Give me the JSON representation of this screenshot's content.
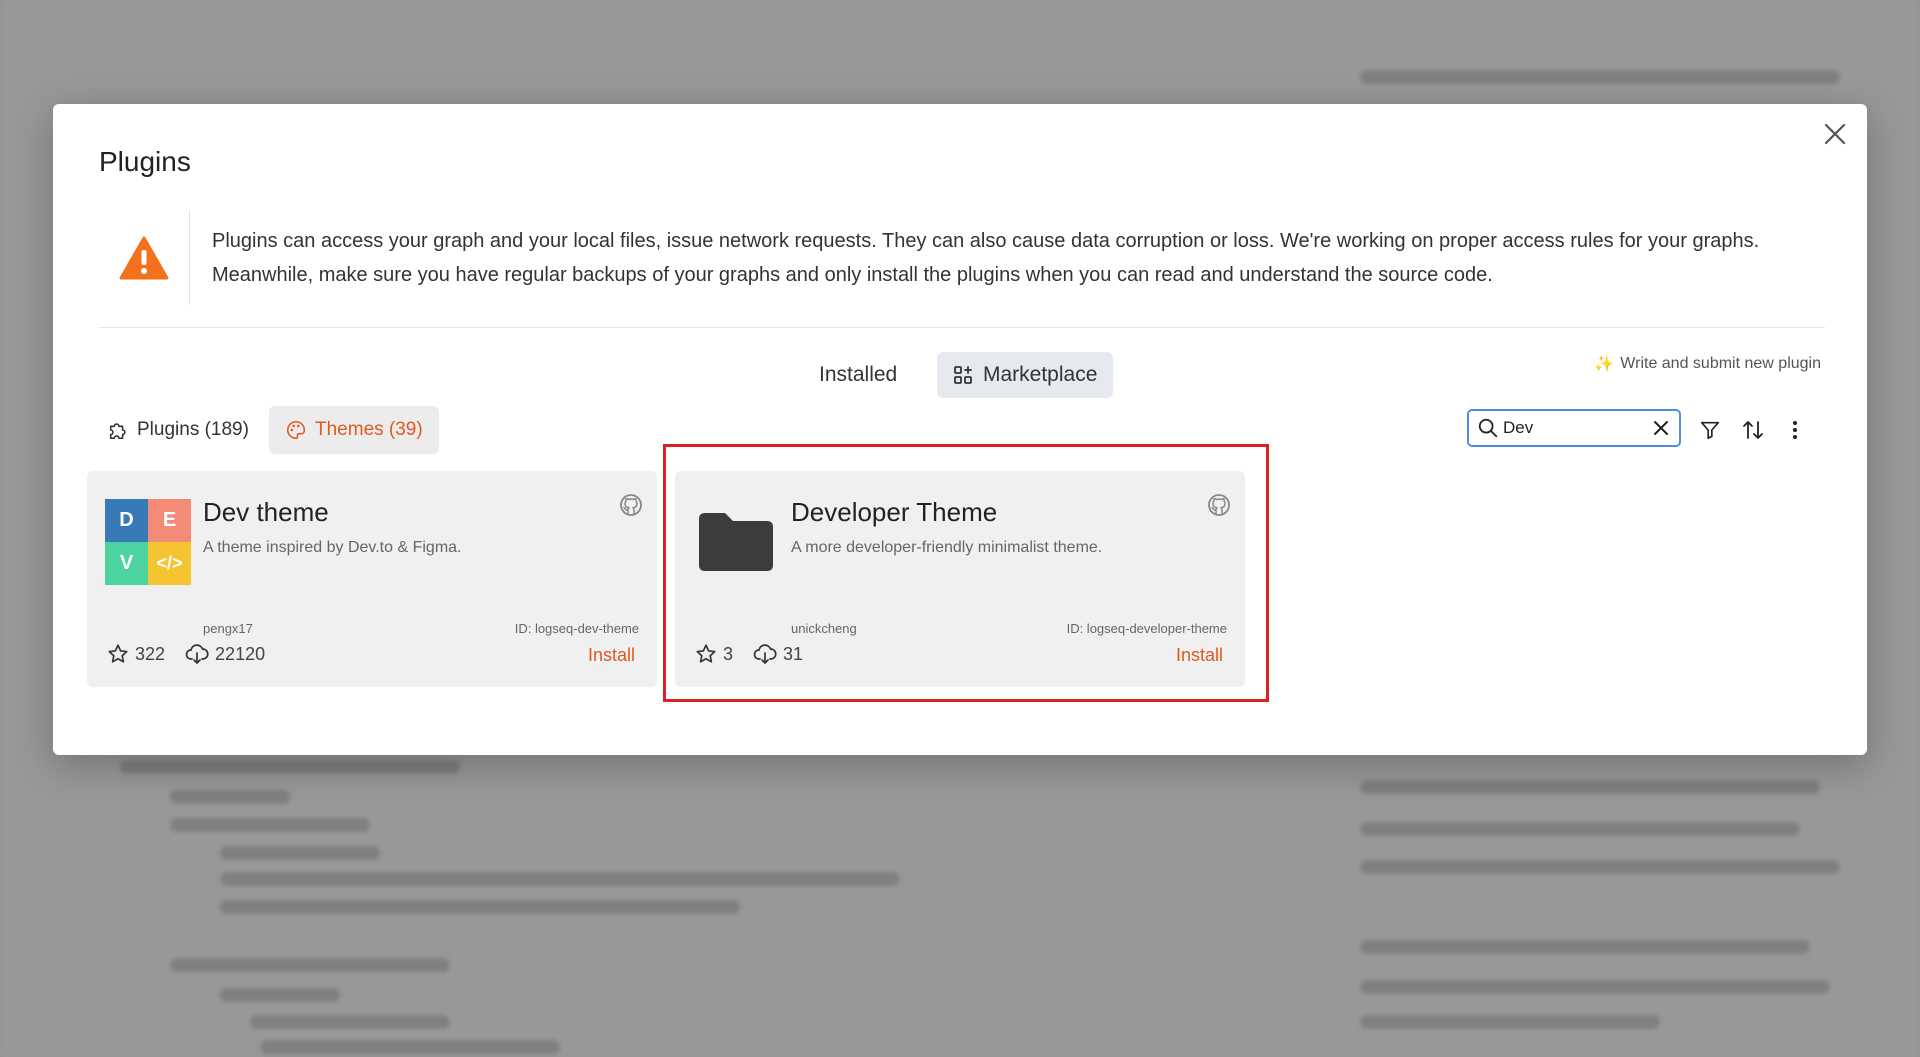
{
  "modal": {
    "title": "Plugins",
    "warning": "Plugins can access your graph and your local files, issue network requests. They can also cause data corruption or loss. We're working on proper access rules for your graphs. Meanwhile, make sure you have regular backups of your graphs and only install the plugins when you can read and understand the source code."
  },
  "tabs": {
    "installed": "Installed",
    "marketplace": "Marketplace"
  },
  "write_link": {
    "emoji": "✨",
    "label": "Write and submit new plugin"
  },
  "filters": {
    "plugins": "Plugins (189)",
    "themes": "Themes (39)"
  },
  "search": {
    "value": "Dev"
  },
  "cards": [
    {
      "name": "Dev theme",
      "description": "A theme inspired by Dev.to & Figma.",
      "author": "pengx17",
      "id": "ID: logseq-dev-theme",
      "stars": "322",
      "downloads": "22120",
      "install": "Install",
      "logo": {
        "d": "D",
        "e": "E",
        "v": "V",
        "code": "</>"
      }
    },
    {
      "name": "Developer Theme",
      "description": "A more developer-friendly minimalist theme.",
      "author": "unickcheng",
      "id": "ID: logseq-developer-theme",
      "stars": "3",
      "downloads": "31",
      "install": "Install"
    }
  ],
  "colors": {
    "accent": "#e05a1e",
    "warning": "#f2711c",
    "highlight": "#dd1f26",
    "logo_blue": "#3879b8",
    "logo_salmon": "#f38b77",
    "logo_green": "#4bd3a0",
    "logo_yellow": "#f5c431"
  }
}
